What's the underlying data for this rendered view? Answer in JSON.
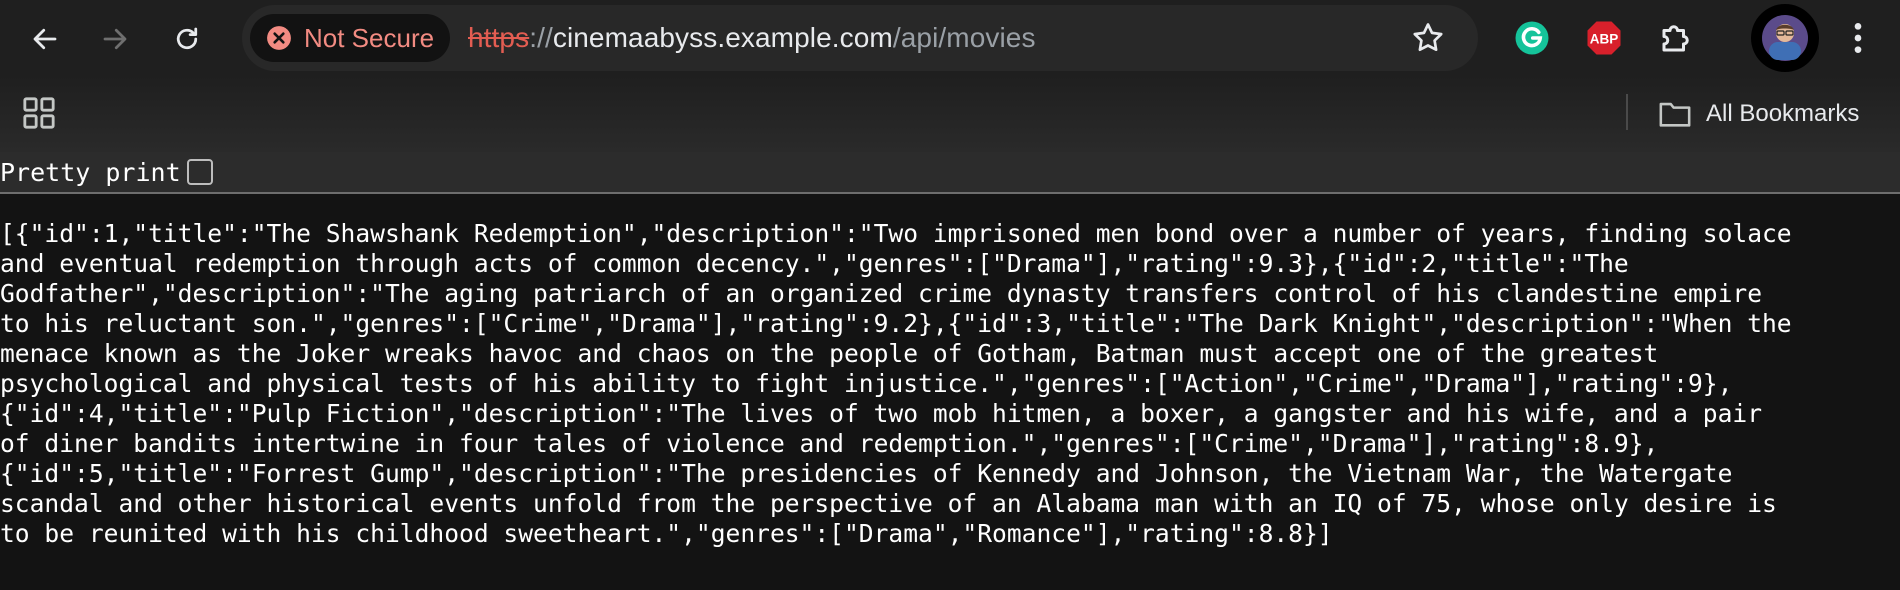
{
  "browser": {
    "security_label": "Not Secure",
    "url": {
      "scheme": "https",
      "separator": "://",
      "host": "cinemaabyss.example.com",
      "path": "/api/movies"
    },
    "extensions": [
      {
        "name": "grammarly-icon",
        "color": "#15c39a"
      },
      {
        "name": "adblock-plus-icon",
        "label": "ABP",
        "color": "#d8202b"
      },
      {
        "name": "extensions-puzzle-icon"
      }
    ],
    "bookmarks": {
      "all_bookmarks_label": "All Bookmarks"
    }
  },
  "viewer": {
    "pretty_print_label": "Pretty print",
    "pretty_print_checked": false,
    "raw_json": "[{\"id\":1,\"title\":\"The Shawshank Redemption\",\"description\":\"Two imprisoned men bond over a number of years, finding solace\nand eventual redemption through acts of common decency.\",\"genres\":[\"Drama\"],\"rating\":9.3},{\"id\":2,\"title\":\"The\nGodfather\",\"description\":\"The aging patriarch of an organized crime dynasty transfers control of his clandestine empire\nto his reluctant son.\",\"genres\":[\"Crime\",\"Drama\"],\"rating\":9.2},{\"id\":3,\"title\":\"The Dark Knight\",\"description\":\"When the\nmenace known as the Joker wreaks havoc and chaos on the people of Gotham, Batman must accept one of the greatest\npsychological and physical tests of his ability to fight injustice.\",\"genres\":[\"Action\",\"Crime\",\"Drama\"],\"rating\":9},\n{\"id\":4,\"title\":\"Pulp Fiction\",\"description\":\"The lives of two mob hitmen, a boxer, a gangster and his wife, and a pair\nof diner bandits intertwine in four tales of violence and redemption.\",\"genres\":[\"Crime\",\"Drama\"],\"rating\":8.9},\n{\"id\":5,\"title\":\"Forrest Gump\",\"description\":\"The presidencies of Kennedy and Johnson, the Vietnam War, the Watergate\nscandal and other historical events unfold from the perspective of an Alabama man with an IQ of 75, whose only desire is\nto be reunited with his childhood sweetheart.\",\"genres\":[\"Drama\",\"Romance\"],\"rating\":8.8}]"
  }
}
